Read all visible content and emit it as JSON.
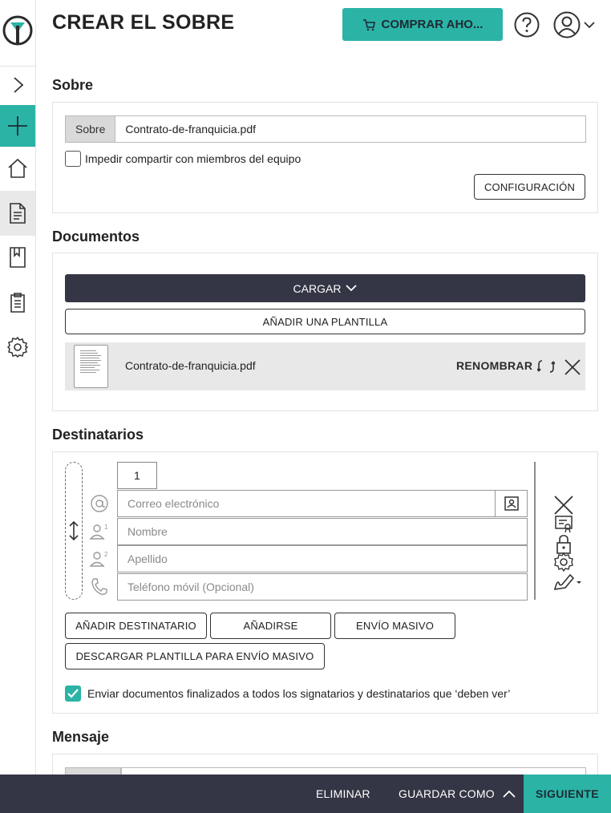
{
  "header": {
    "title": "CREAR EL SOBRE",
    "buy_label": "COMPRAR AHO..."
  },
  "envelope": {
    "section_title": "Sobre",
    "field_label": "Sobre",
    "field_value": "Contrato-de-franquicia.pdf",
    "no_share_label": "Impedir compartir con miembros del equipo",
    "no_share_checked": false,
    "config_label": "CONFIGURACIÓN"
  },
  "documents": {
    "section_title": "Documentos",
    "upload_label": "CARGAR",
    "add_template_label": "AÑADIR UNA PLANTILLA",
    "files": [
      {
        "name": "Contrato-de-franquicia.pdf",
        "rename_label": "RENOMBRAR"
      }
    ]
  },
  "recipients": {
    "section_title": "Destinatarios",
    "list": [
      {
        "order": "1",
        "email_placeholder": "Correo electrónico",
        "first_name_placeholder": "Nombre",
        "last_name_placeholder": "Apellido",
        "phone_placeholder": "Teléfono móvil (Opcional)"
      }
    ],
    "add_recipient_label": "AÑADIR DESTINATARIO",
    "add_self_label": "AÑADIRSE",
    "bulk_send_label": "ENVÍO MASIVO",
    "download_bulk_template_label": "DESCARGAR PLANTILLA PARA ENVÍO MASIVO",
    "send_finished_label": "Enviar documentos finalizados a todos los signatarios y destinatarios que ‘deben ver’",
    "send_finished_checked": true
  },
  "message": {
    "section_title": "Mensaje"
  },
  "footer": {
    "delete_label": "ELIMINAR",
    "save_as_label": "GUARDAR COMO",
    "next_label": "SIGUIENTE"
  },
  "colors": {
    "accent": "#2bb3a6",
    "dark": "#343645"
  }
}
